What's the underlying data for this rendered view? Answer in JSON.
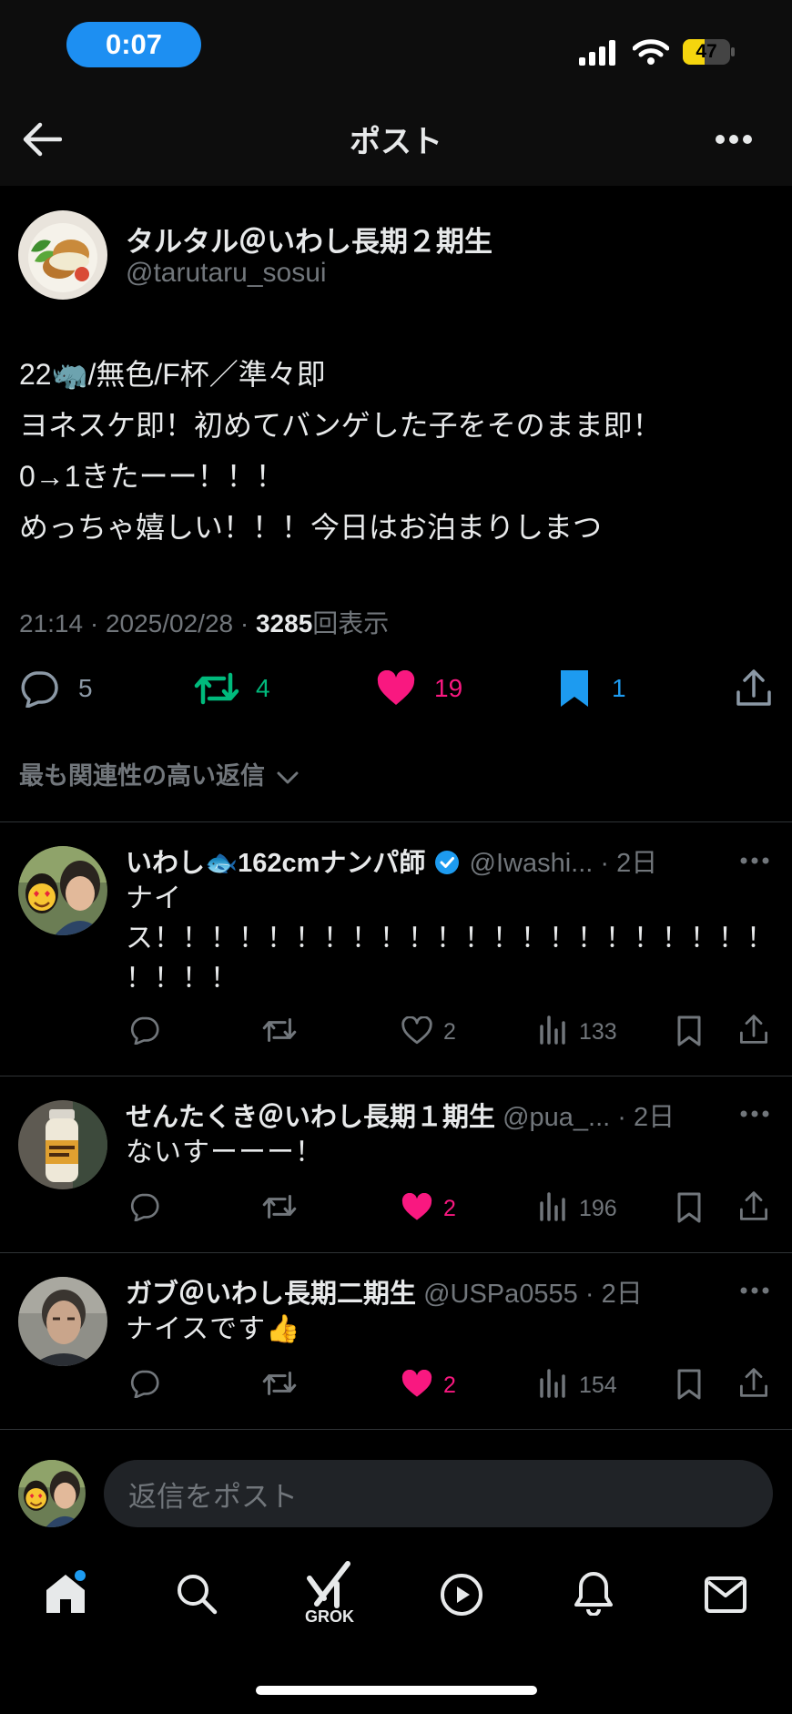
{
  "status": {
    "time": "0:07",
    "battery": "47",
    "battery_level": 0.47
  },
  "header": {
    "title": "ポスト"
  },
  "post": {
    "author_name": "タルタル＠いわし長期２期生",
    "author_handle": "@tarutaru_sosui",
    "lines": [
      "22🦏/無色/F杯／準々即",
      "ヨネスケ即！初めてバンゲした子をそのまま即！",
      "0→1きたーー！！！",
      "めっちゃ嬉しい！！！今日はお泊まりしまつ"
    ],
    "time": "21:14 · 2025/02/28 · ",
    "views": "3285",
    "views_label": "回表示",
    "stats": {
      "replies": "5",
      "reposts": "4",
      "likes": "19",
      "bookmarks": "1"
    },
    "colors": {
      "repost": "#00ba7c",
      "like": "#f91880",
      "bookmark": "#1d9bf0"
    }
  },
  "sort": {
    "label": "最も関連性の高い返信"
  },
  "replies": [
    {
      "name": "いわし🐟162cmナンパ師",
      "verified": true,
      "handle": "@Iwashi...",
      "time": "· 2日",
      "lines": [
        "ナイ",
        "ス！！！！！！！！！！！！！！！！！！！！！！",
        "！！！！"
      ],
      "like_count": "2",
      "liked": false,
      "views": "133"
    },
    {
      "name": "せんたくき＠いわし長期１期生",
      "verified": false,
      "handle": "@pua_...",
      "time": "· 2日",
      "lines": [
        "ないすーーー！"
      ],
      "like_count": "2",
      "liked": true,
      "views": "196"
    },
    {
      "name": "ガブ＠いわし長期二期生",
      "verified": false,
      "handle": "@USPa0555",
      "time": "· 2日",
      "lines": [
        "ナイスです👍"
      ],
      "like_count": "2",
      "liked": true,
      "views": "154"
    }
  ],
  "compose": {
    "placeholder": "返信をポスト"
  },
  "nav": {
    "grok_label": "GROK"
  }
}
